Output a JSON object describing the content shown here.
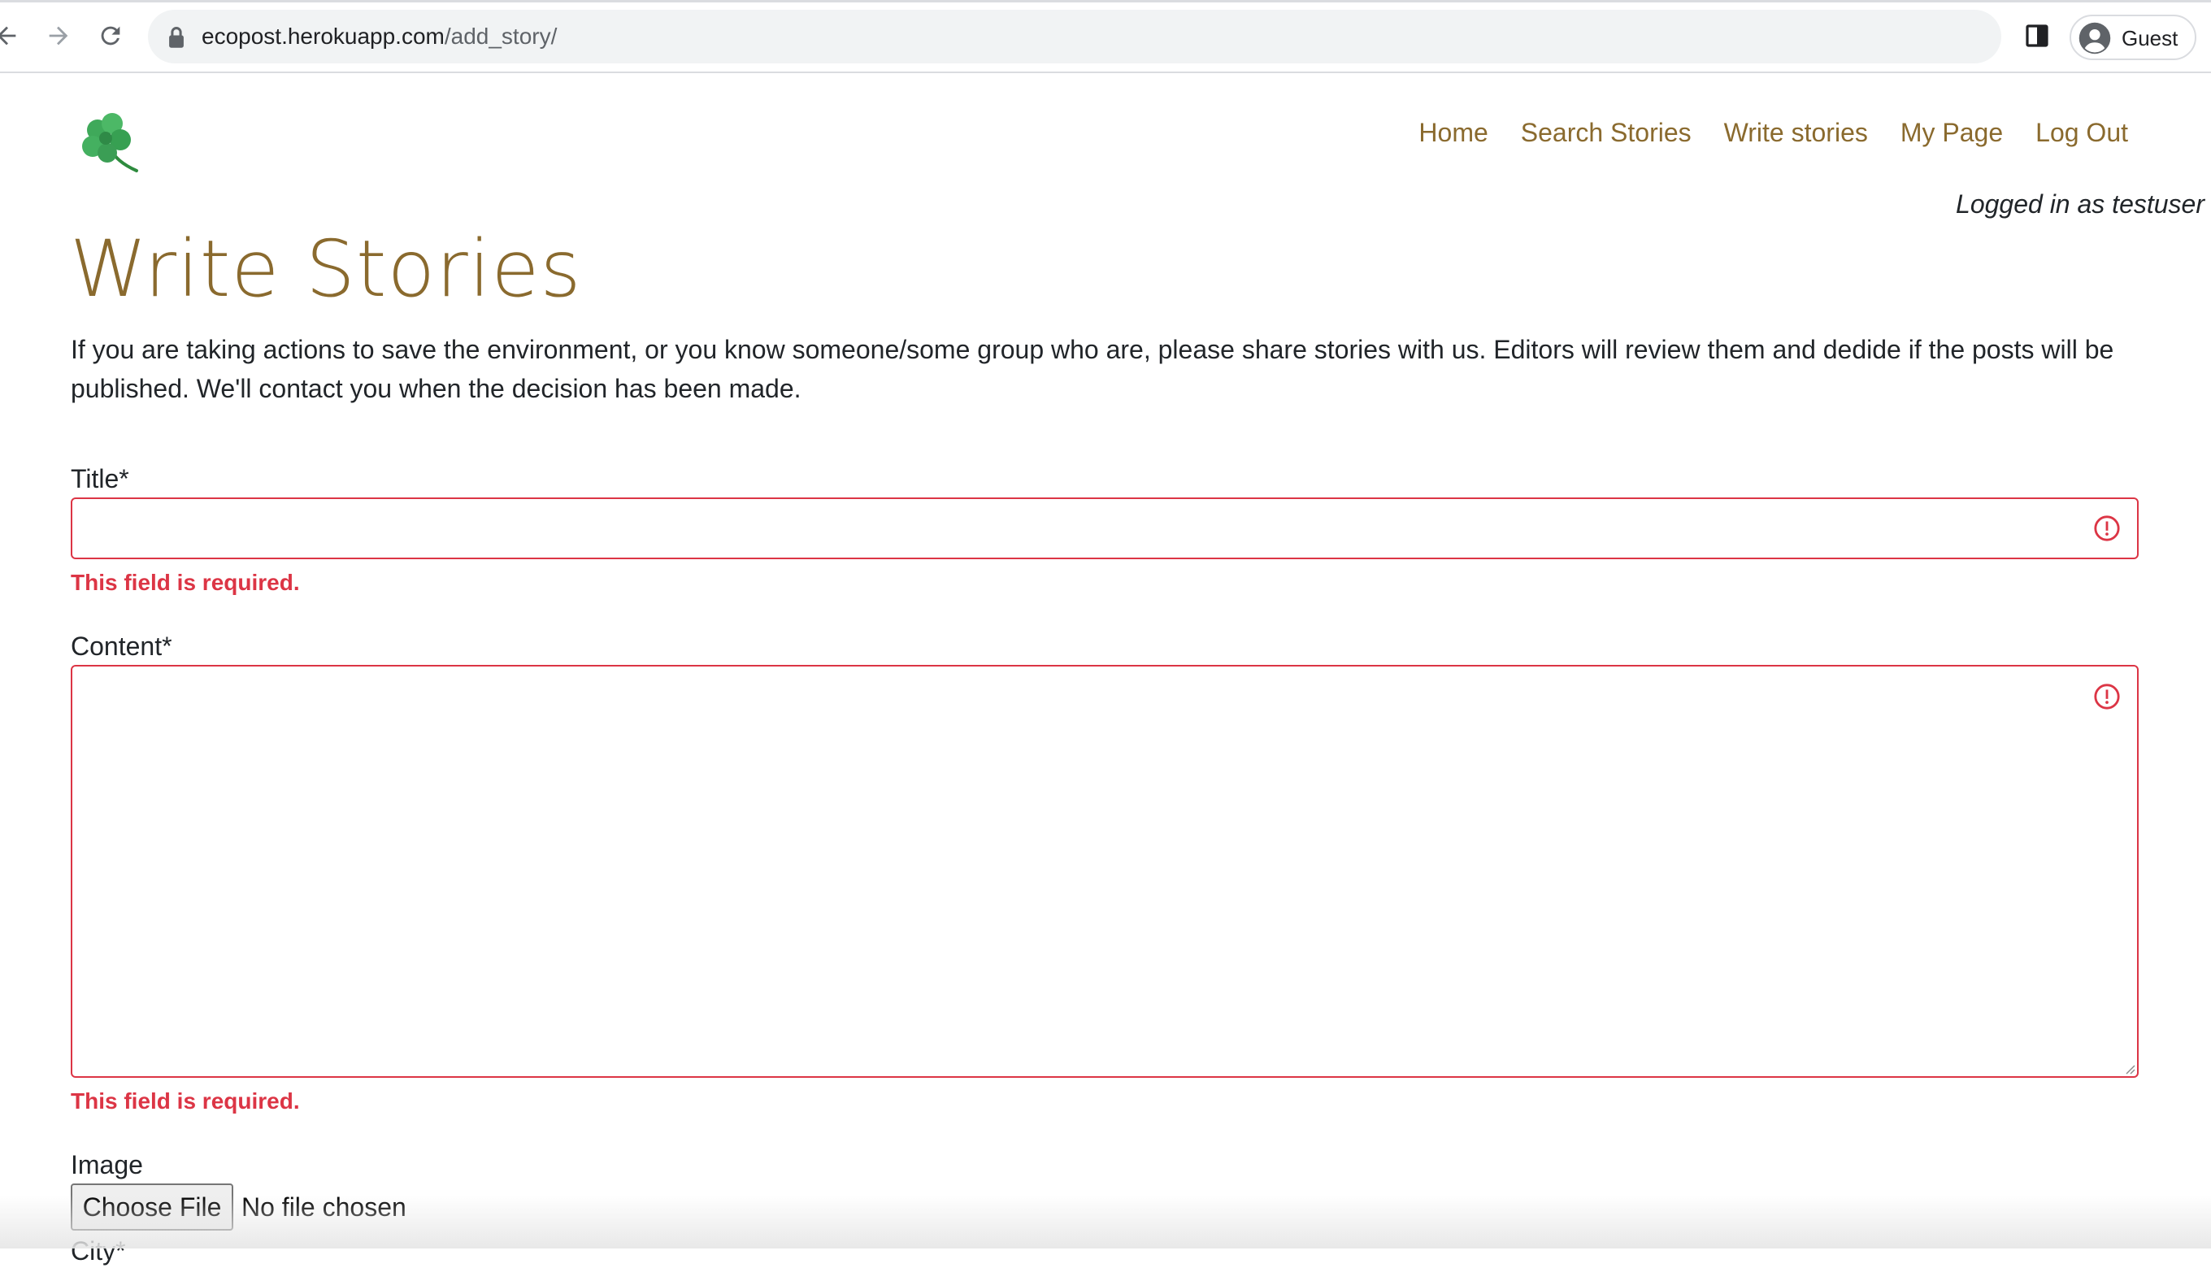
{
  "browser": {
    "url_host": "ecopost.herokuapp.com",
    "url_path": "/add_story/",
    "profile_label": "Guest"
  },
  "nav": {
    "items": [
      {
        "label": "Home"
      },
      {
        "label": "Search Stories"
      },
      {
        "label": "Write stories"
      },
      {
        "label": "My Page"
      },
      {
        "label": "Log Out"
      }
    ],
    "logged_in_text": "Logged in as testuser"
  },
  "page": {
    "title": "Write Stories",
    "intro": "If you are taking actions to save the environment, or you know someone/some group who are, please share stories with us. Editors will review them and dedide if the posts will be published. We'll contact you when the decision has been made."
  },
  "form": {
    "title_label": "Title*",
    "title_value": "",
    "title_error": "This field is required.",
    "content_label": "Content*",
    "content_value": "",
    "content_error": "This field is required.",
    "image_label": "Image",
    "choose_file_label": "Choose File",
    "file_status": "No file chosen",
    "city_label": "City*"
  },
  "colors": {
    "accent": "#8a6a2e",
    "error": "#dc3545"
  }
}
